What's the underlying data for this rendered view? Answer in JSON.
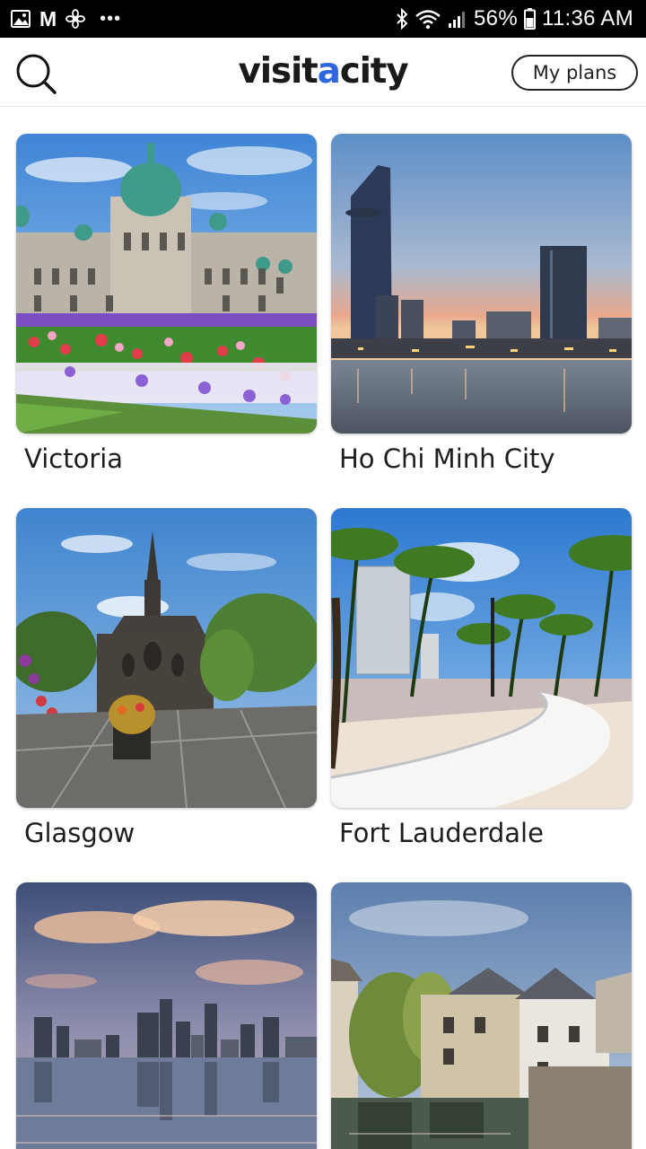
{
  "brand_accent_color": "#2f66e0",
  "status_bar": {
    "left_icons": [
      "gallery-icon",
      "gmail-icon",
      "fan-icon",
      "more-dots-icon"
    ],
    "gmail_label": "M",
    "more_label": "•••",
    "right_icons": [
      "bluetooth-icon",
      "wifi-icon",
      "signal-icon",
      "battery-icon"
    ],
    "battery": "56%",
    "time": "11:36 AM"
  },
  "header": {
    "logo_part_1": "visit",
    "logo_accent": "a",
    "logo_part_2": "city",
    "search_icon": "search-icon",
    "my_plans_label": "My plans"
  },
  "cities": [
    {
      "name": "Victoria"
    },
    {
      "name": "Ho Chi Minh City"
    },
    {
      "name": "Glasgow"
    },
    {
      "name": "Fort Lauderdale"
    },
    {
      "name": ""
    },
    {
      "name": ""
    }
  ]
}
